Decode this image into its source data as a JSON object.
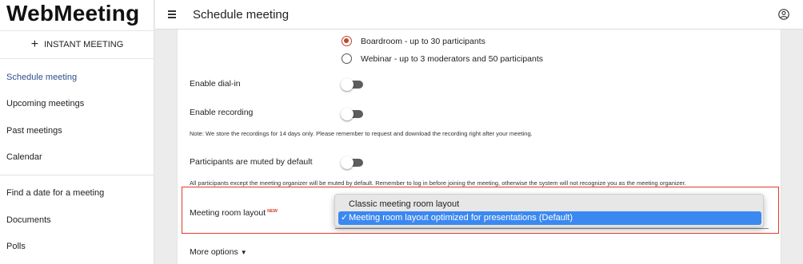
{
  "app": {
    "logo": "WebMeeting"
  },
  "sidebar": {
    "instant_meeting": "INSTANT MEETING",
    "items": [
      {
        "label": "Schedule meeting",
        "active": true
      },
      {
        "label": "Upcoming meetings"
      },
      {
        "label": "Past meetings"
      },
      {
        "label": "Calendar"
      },
      {
        "label": "Find a date for a meeting"
      },
      {
        "label": "Documents"
      },
      {
        "label": "Polls"
      }
    ]
  },
  "header": {
    "title": "Schedule meeting",
    "menu_icon": "hamburger-icon",
    "account_icon": "account-circle-icon"
  },
  "form": {
    "room_types": [
      {
        "label": "Boardroom - up to 30 participants",
        "selected": true
      },
      {
        "label": "Webinar - up to 3 moderators and 50 participants",
        "selected": false
      }
    ],
    "dial_in": {
      "label": "Enable dial-in",
      "enabled": false
    },
    "recording": {
      "label": "Enable recording",
      "enabled": false,
      "note": "Note: We store the recordings for 14 days only. Please remember to request and download the recording right after your meeting."
    },
    "muted": {
      "label": "Participants are muted by default",
      "enabled": false,
      "note": "All participants except the meeting organizer will be muted by default. Remember to log in before joining the meeting, otherwise the system will not recognize you as the meeting organizer."
    },
    "layout": {
      "label": "Meeting room layout",
      "badge": "NEW",
      "options": [
        {
          "label": "Classic meeting room layout",
          "selected": false,
          "check": ""
        },
        {
          "label": "Meeting room layout optimized for presentations (Default)",
          "selected": true,
          "check": "✓"
        }
      ]
    },
    "more_options": "More options",
    "more_options_caret": "▼"
  },
  "colors": {
    "accent": "#2d4f8e",
    "radio_selected": "#c0432b",
    "highlight_border": "#e23a2e",
    "selection": "#3b88f0"
  }
}
